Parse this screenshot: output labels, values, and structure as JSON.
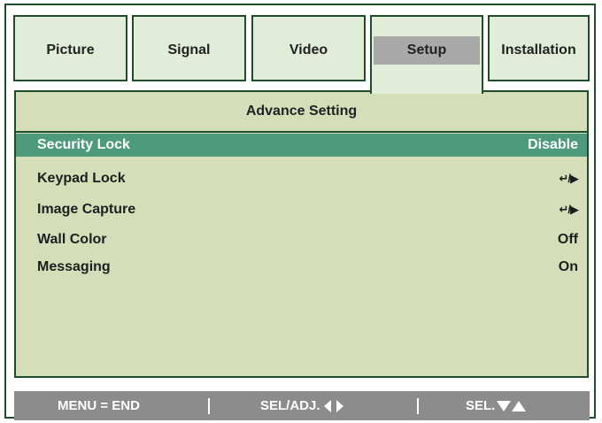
{
  "tabs": [
    {
      "label": "Picture",
      "active": false
    },
    {
      "label": "Signal",
      "active": false
    },
    {
      "label": "Video",
      "active": false
    },
    {
      "label": "Setup",
      "active": true
    },
    {
      "label": "Installation",
      "active": false
    }
  ],
  "panel": {
    "title": "Advance Setting",
    "rows": [
      {
        "label": "Security Lock",
        "value": "Disable",
        "selected": true
      },
      {
        "label": "Keypad Lock",
        "value_icon": "enter-or-right-arrow-icon",
        "value": "↵/▶"
      },
      {
        "label": "Image Capture",
        "value_icon": "enter-or-right-arrow-icon",
        "value": "↵/▶"
      },
      {
        "label": "Wall Color",
        "value": "Off"
      },
      {
        "label": "Messaging",
        "value": "On"
      }
    ]
  },
  "footer": {
    "menu_hint": "MENU = END",
    "adjust_hint": "SEL/ADJ.",
    "select_hint": "SEL."
  },
  "colors": {
    "border": "#1f4d2a",
    "panel_bg": "#d4dfba",
    "tab_bg": "#e2edd9",
    "active_tab_label_bg": "#a9a9a9",
    "selected_row_bg": "#4e9a7d",
    "footer_bg": "#8c8c8c"
  }
}
